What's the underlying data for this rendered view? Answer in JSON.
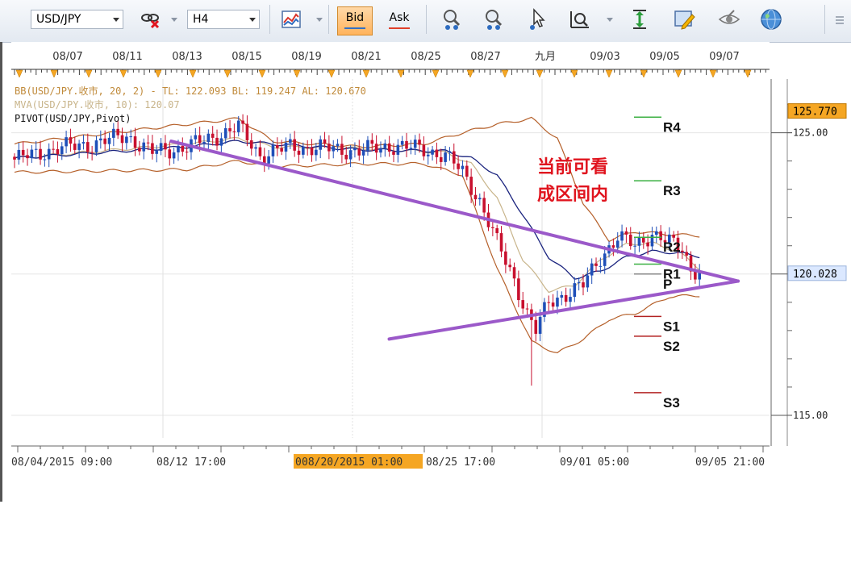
{
  "toolbar": {
    "symbol": "USD/JPY",
    "timeframe": "H4",
    "bid_label": "Bid",
    "ask_label": "Ask",
    "bid_color": "#3370c4",
    "ask_color": "#e0402a",
    "icons": [
      "symbol-dropdown-icon",
      "link-off-icon",
      "timeframe-dropdown-icon",
      "chart-type-icon",
      "zoom-in-icon",
      "zoom-out-icon",
      "cursor-icon",
      "magnifier-icon",
      "price-scale-icon",
      "note-icon",
      "visibility-icon",
      "globe-icon",
      "menu-icon"
    ]
  },
  "chart_data": {
    "type": "candlestick",
    "symbol": "USD/JPY",
    "timeframe": "H4",
    "indicators": {
      "bb": "BB(USD/JPY.收市, 20, 2) - TL: 122.093  BL: 119.247  AL: 120.670",
      "mva": "MVA(USD/JPY.收市, 10): 120.07",
      "pivot": "PIVOT(USD/JPY,Pivot)"
    },
    "top_date_labels": [
      "08/07",
      "08/11",
      "08/13",
      "08/15",
      "08/19",
      "08/21",
      "08/25",
      "08/27",
      "九月",
      "09/03",
      "09/05",
      "09/07"
    ],
    "bottom_time_labels": [
      "08/04/2015 09:00",
      "08/12 17:00",
      "08/20/2015 01:00",
      "08/25 17:00",
      "09/01 05:00",
      "09/05 21:00"
    ],
    "bottom_highlight_prefix": "0",
    "y_ticks": [
      "125.00",
      "120.00",
      "115.00"
    ],
    "y_tick_values": [
      125.0,
      120.0,
      115.0
    ],
    "ylim": [
      114.2,
      126.9
    ],
    "price_boxes": [
      {
        "value": 125.77,
        "label": "125.770",
        "bg": "#f5a623"
      },
      {
        "value": 120.028,
        "label": "120.028",
        "bg": "#dbe8ff"
      }
    ],
    "pivot_levels": [
      {
        "name": "R4",
        "value": 125.55,
        "color": "#3cb043"
      },
      {
        "name": "R3",
        "value": 123.3,
        "color": "#3cb043"
      },
      {
        "name": "R2",
        "value": 121.3,
        "color": "#3cb043"
      },
      {
        "name": "R1",
        "value": 120.35,
        "color": "#3cb043"
      },
      {
        "name": "P",
        "value": 120.0,
        "color": "#888888"
      },
      {
        "name": "S1",
        "value": 118.5,
        "color": "#b22222"
      },
      {
        "name": "S2",
        "value": 117.8,
        "color": "#b22222"
      },
      {
        "name": "S3",
        "value": 115.8,
        "color": "#b22222"
      }
    ],
    "triangle": {
      "color": "#9b59c9",
      "upper": [
        [
          0.22,
          124.7
        ],
        [
          1.0,
          119.75
        ]
      ],
      "lower": [
        [
          0.52,
          117.7
        ],
        [
          1.0,
          119.75
        ]
      ]
    },
    "annotation": {
      "lines": [
        "当前可看",
        "成区间内"
      ],
      "color": "#e0141e"
    },
    "candle_count": 160,
    "close_path": [
      [
        0,
        124.05
      ],
      [
        10,
        124.45
      ],
      [
        18,
        124.6
      ],
      [
        26,
        124.9
      ],
      [
        32,
        124.3
      ],
      [
        40,
        124.5
      ],
      [
        48,
        124.95
      ],
      [
        52,
        125.2
      ],
      [
        57,
        124.2
      ],
      [
        64,
        124.5
      ],
      [
        72,
        124.45
      ],
      [
        80,
        124.35
      ],
      [
        88,
        124.55
      ],
      [
        95,
        124.4
      ],
      [
        100,
        124.2
      ],
      [
        104,
        123.6
      ],
      [
        108,
        122.6
      ],
      [
        112,
        121.1
      ],
      [
        116,
        119.8
      ],
      [
        119,
        118.6
      ],
      [
        121,
        118.0
      ],
      [
        124,
        119.0
      ],
      [
        128,
        119.3
      ],
      [
        132,
        119.6
      ],
      [
        136,
        120.6
      ],
      [
        140,
        121.3
      ],
      [
        144,
        121.0
      ],
      [
        148,
        121.45
      ],
      [
        152,
        121.1
      ],
      [
        155,
        120.9
      ],
      [
        157,
        120.2
      ],
      [
        160,
        120.03
      ]
    ],
    "spike_low": 116.05,
    "bb_upper": [
      [
        0,
        124.6
      ],
      [
        40,
        125.3
      ],
      [
        52,
        125.5
      ],
      [
        60,
        124.7
      ],
      [
        80,
        124.5
      ],
      [
        95,
        124.6
      ],
      [
        104,
        125.0
      ],
      [
        112,
        125.3
      ],
      [
        120,
        125.5
      ],
      [
        126,
        124.8
      ],
      [
        132,
        122.5
      ],
      [
        138,
        121.2
      ],
      [
        144,
        121.5
      ],
      [
        152,
        121.4
      ],
      [
        160,
        121.35
      ]
    ],
    "bb_lower": [
      [
        0,
        123.6
      ],
      [
        40,
        123.7
      ],
      [
        52,
        124.0
      ],
      [
        60,
        123.8
      ],
      [
        80,
        123.9
      ],
      [
        95,
        123.9
      ],
      [
        104,
        123.5
      ],
      [
        112,
        120.2
      ],
      [
        120,
        117.6
      ],
      [
        126,
        117.2
      ],
      [
        132,
        117.7
      ],
      [
        138,
        118.4
      ],
      [
        144,
        118.6
      ],
      [
        152,
        119.2
      ],
      [
        160,
        119.25
      ]
    ],
    "mva_path": [
      [
        0,
        124.1
      ],
      [
        40,
        124.6
      ],
      [
        52,
        124.8
      ],
      [
        60,
        124.5
      ],
      [
        80,
        124.45
      ],
      [
        100,
        124.3
      ],
      [
        106,
        123.9
      ],
      [
        112,
        122.7
      ],
      [
        118,
        120.5
      ],
      [
        124,
        119.4
      ],
      [
        130,
        119.6
      ],
      [
        136,
        120.5
      ],
      [
        142,
        121.05
      ],
      [
        148,
        121.1
      ],
      [
        154,
        120.8
      ],
      [
        160,
        120.07
      ]
    ],
    "ma20_path": [
      [
        0,
        124.1
      ],
      [
        40,
        124.5
      ],
      [
        52,
        124.7
      ],
      [
        60,
        124.6
      ],
      [
        80,
        124.4
      ],
      [
        100,
        124.35
      ],
      [
        106,
        124.1
      ],
      [
        112,
        123.5
      ],
      [
        118,
        122.1
      ],
      [
        124,
        120.6
      ],
      [
        130,
        119.85
      ],
      [
        136,
        120.1
      ],
      [
        142,
        120.6
      ],
      [
        148,
        120.8
      ],
      [
        154,
        120.75
      ],
      [
        160,
        120.6
      ]
    ],
    "title": "",
    "xlabel": "",
    "ylabel": ""
  }
}
